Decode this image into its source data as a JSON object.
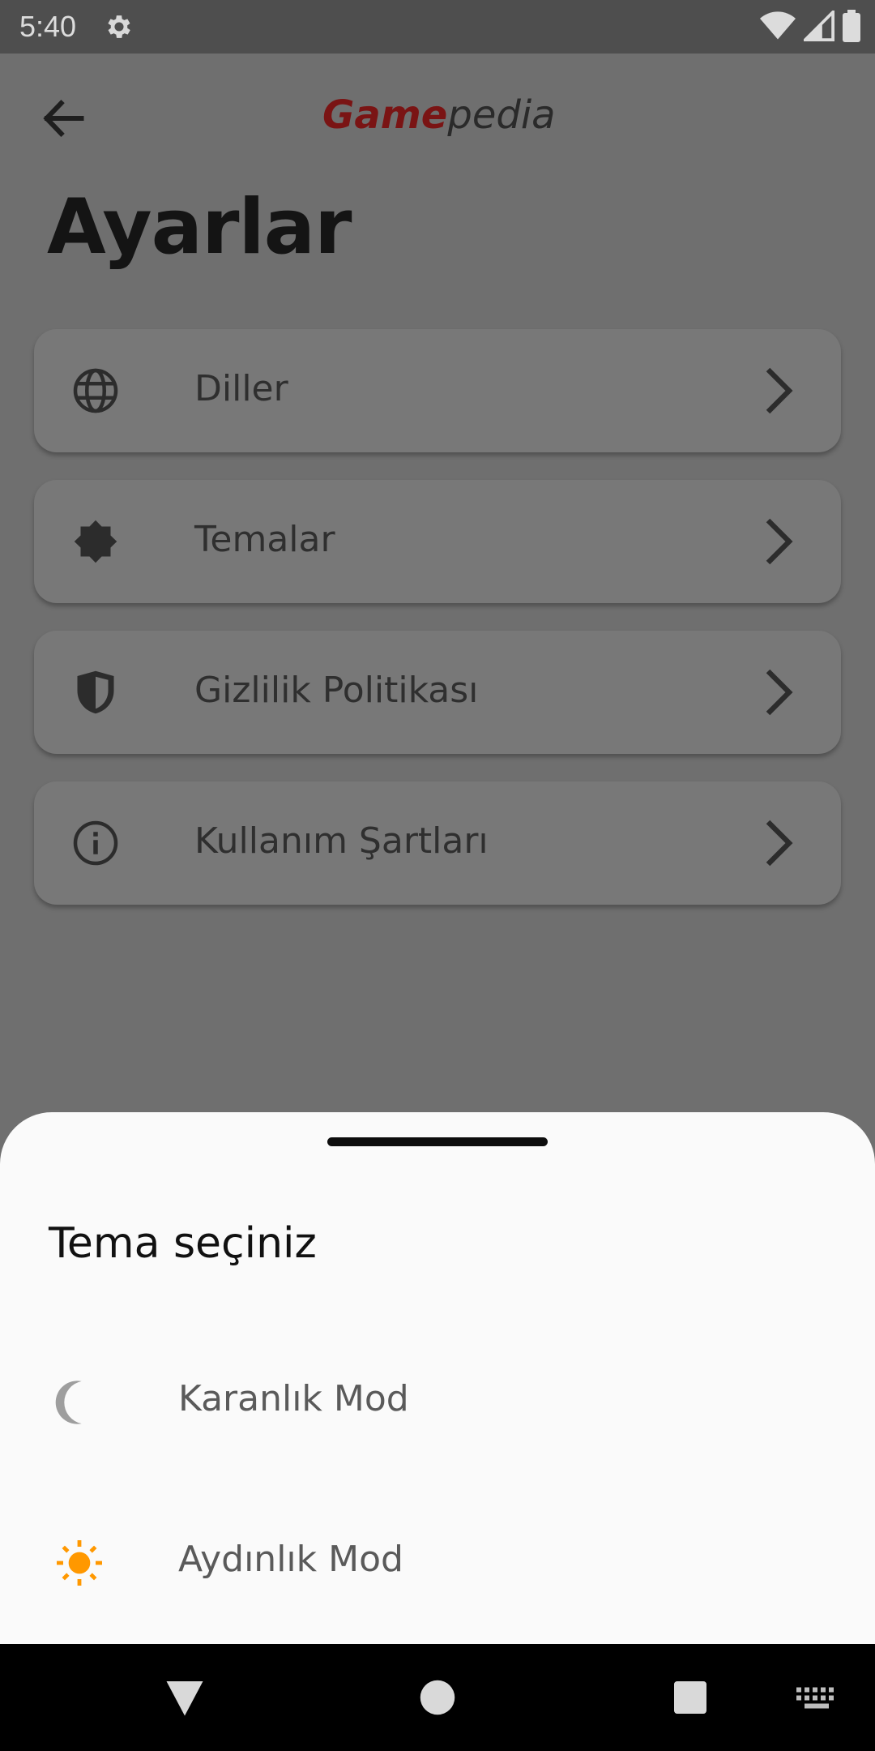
{
  "status_bar": {
    "time": "5:40",
    "icons": [
      "gear-icon",
      "wifi-icon",
      "cellular-signal-icon",
      "battery-icon"
    ]
  },
  "header": {
    "back_icon": "arrow-left-icon",
    "logo_primary": "Game",
    "logo_secondary": "pedia",
    "brand_color": "#7a1414"
  },
  "page": {
    "title": "Ayarlar"
  },
  "settings_items": [
    {
      "label": "Diller",
      "icon": "globe-icon"
    },
    {
      "label": "Temalar",
      "icon": "theme-brightness-icon"
    },
    {
      "label": "Gizlilik Politikası",
      "icon": "shield-icon"
    },
    {
      "label": "Kullanım Şartları",
      "icon": "info-icon"
    }
  ],
  "theme_sheet": {
    "title": "Tema seçiniz",
    "options": [
      {
        "label": "Karanlık Mod",
        "icon": "moon-icon",
        "icon_color": "#9e9e9e"
      },
      {
        "label": "Aydınlık Mod",
        "icon": "sun-icon",
        "icon_color": "#ff9800"
      }
    ]
  },
  "nav_bar": {
    "buttons": [
      "back-triangle-icon",
      "home-circle-icon",
      "recents-square-icon",
      "keyboard-icon"
    ]
  }
}
